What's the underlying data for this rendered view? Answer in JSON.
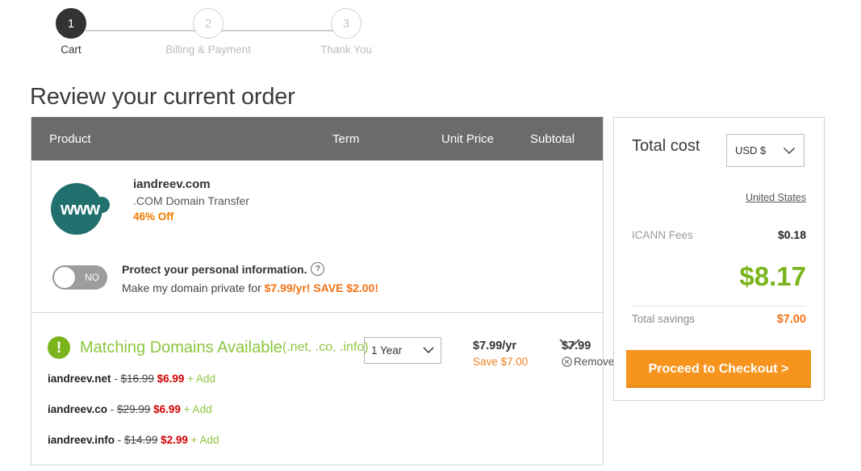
{
  "stepper": {
    "steps": [
      {
        "number": "1",
        "label": "Cart",
        "state": "active"
      },
      {
        "number": "2",
        "label": "Billing & Payment",
        "state": "inactive"
      },
      {
        "number": "3",
        "label": "Thank You",
        "state": "inactive"
      }
    ]
  },
  "page": {
    "title": "Review your current order"
  },
  "cart": {
    "columns": {
      "product": "Product",
      "term": "Term",
      "unit_price": "Unit Price",
      "subtotal": "Subtotal"
    },
    "item": {
      "logo_text": "www",
      "name": "iandreev.com",
      "description": ".COM Domain Transfer",
      "discount_badge": "46% Off",
      "term_value": "1 Year",
      "unit_price": "$7.99/yr",
      "unit_price_save": "Save $7.00",
      "subtotal": "$7.99",
      "remove_label": "Remove"
    },
    "privacy": {
      "toggle_state": "NO",
      "headline": "Protect your personal information.",
      "help_glyph": "?",
      "offer_prefix": "Make my domain private for ",
      "offer_price": "$7.99/yr! SAVE $2.00!"
    },
    "matching": {
      "alert_glyph": "!",
      "title": "Matching Domains Available ",
      "tlds": "(.net, .co, .info)",
      "domains": [
        {
          "name": "iandreev.net",
          "separator": " - ",
          "old_price": "$16.99",
          "new_price": "$6.99",
          "add_label": "+ Add"
        },
        {
          "name": "iandreev.co",
          "separator": " - ",
          "old_price": "$29.99",
          "new_price": "$6.99",
          "add_label": "+ Add"
        },
        {
          "name": "iandreev.info",
          "separator": " - ",
          "old_price": "$14.99",
          "new_price": "$2.99",
          "add_label": "+ Add"
        }
      ]
    }
  },
  "total_panel": {
    "title": "Total cost",
    "currency": "USD $",
    "country_link": "United States",
    "icann_label": "ICANN Fees",
    "icann_value": "$0.18",
    "grand_total": "$8.17",
    "savings_label": "Total savings",
    "savings_value": "$7.00",
    "checkout_label": "Proceed to Checkout >"
  },
  "colors": {
    "accent_orange": "#f7941d",
    "accent_green": "#7ab51d",
    "logo_teal": "#20706e",
    "header_gray": "#6b6b6b",
    "sale_red": "#d40000"
  }
}
